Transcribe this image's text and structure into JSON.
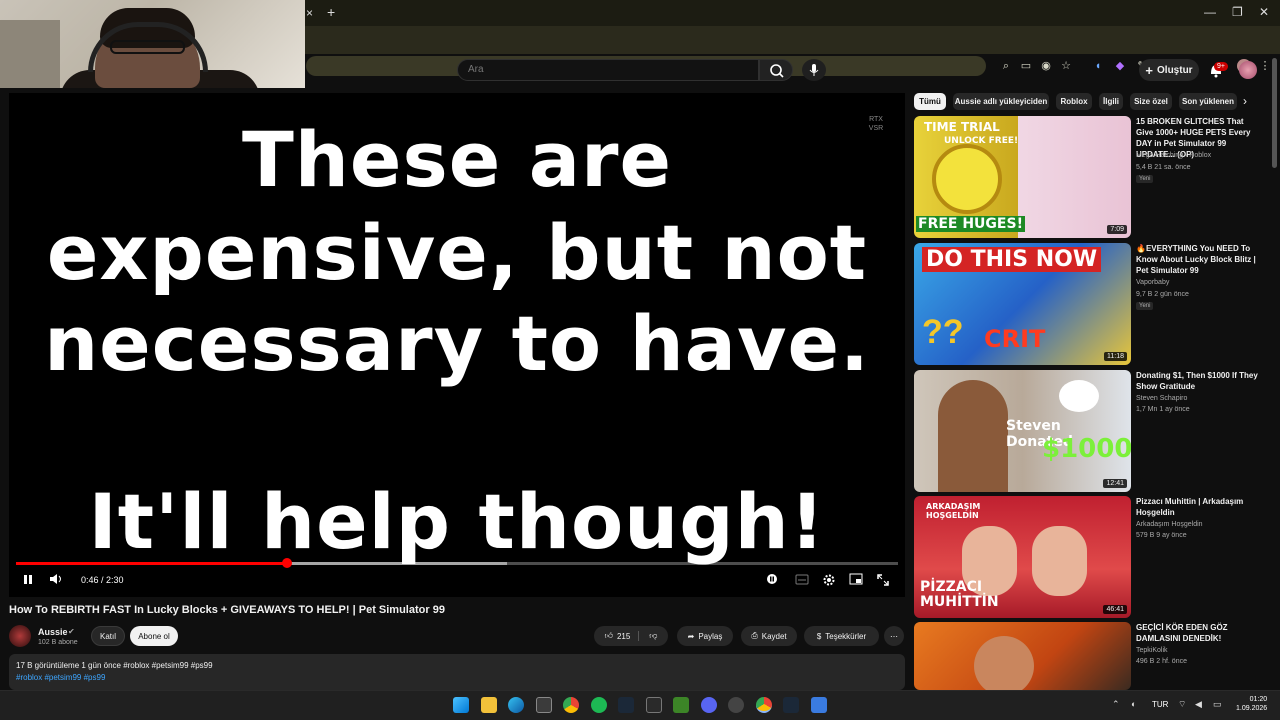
{
  "browser": {
    "new_tab_label": "+",
    "close_tab_label": "×"
  },
  "youtube": {
    "search": {
      "placeholder": "Ara"
    },
    "create_label": "Oluştur",
    "notification_count": "9+"
  },
  "player": {
    "caption_lines": [
      "These are",
      "expensive, but not",
      "necessary to have.",
      "It'll help though!"
    ],
    "rtx_label": "RTX VSR",
    "current_time": "0:46",
    "duration": "2:30",
    "time_display": "0:46 / 2:30",
    "progress_fraction": 0.307,
    "buffer_fraction": 0.557
  },
  "video": {
    "title": "How To REBIRTH FAST In Lucky Blocks + GIVEAWAYS TO HELP! | Pet Simulator 99",
    "channel": "Aussie",
    "subscribers": "102 B abone",
    "join_label": "Katıl",
    "subscribe_label": "Abone ol",
    "likes": "215",
    "share_label": "Paylaş",
    "save_label": "Kaydet",
    "thanks_label": "Teşekkürler",
    "description_meta": "17 B görüntüleme  1 gün önce  #roblox #petsim99 #ps99",
    "description_tags": "#roblox #petsim99 #ps99"
  },
  "sidebar": {
    "chips": [
      "Tümü",
      "Aussie adlı yükleyiciden",
      "Roblox",
      "İlgili",
      "Size özel",
      "Son yüklenen"
    ],
    "recommendations": [
      {
        "title": "15 BROKEN GLITCHES That Give 1000+ HUGE PETS Every DAY in Pet Simulator 99 UPDATE... (OP)",
        "channel": "Mega Hatching · Roblox",
        "meta": "5,4 B  21 sa. önce",
        "badge": "Yeni",
        "duration": "7:09",
        "thumb_text_top": "TIME TRIAL",
        "thumb_text_sub": "UNLOCK FREE!",
        "thumb_text_bottom": "FREE HUGES!"
      },
      {
        "title": "🔥EVERYTHING  You NEED To Know About Lucky Block Blitz | Pet Simulator 99",
        "channel": "Vaporbaby",
        "meta": "9,7 B  2 gün önce",
        "badge": "Yeni",
        "duration": "11:18",
        "thumb_text_top": "DO THIS NOW",
        "thumb_text_bottom": "CRIT"
      },
      {
        "title": "Donating $1, Then $1000 If They Show Gratitude",
        "channel": "Steven Schapiro",
        "meta": "1,7 Mn  1 ay önce",
        "duration": "12:41",
        "thumb_text_top": "Steven Donated",
        "thumb_text_bottom": "$1000"
      },
      {
        "title": "Pizzacı Muhittin | Arkadaşım Hoşgeldin",
        "channel": "Arkadaşım Hoşgeldin",
        "meta": "579 B  9 ay önce",
        "duration": "46:41",
        "thumb_text_top": "ARKADAŞIM HOŞGELDİN",
        "thumb_text_bottom": "PİZZACI MUHİTTİN"
      },
      {
        "title": "GEÇİCİ KÖR EDEN GÖZ DAMLASINI DENEDİK!",
        "channel": "TepkiKolik",
        "meta": "496 B  2 hf. önce"
      }
    ]
  },
  "taskbar": {
    "language": "TUR",
    "time": "01:20",
    "date": "1.09.2026"
  },
  "colors": {
    "accent_red": "#ff0000",
    "link_blue": "#3ea6ff",
    "background": "#0f0f0f"
  }
}
